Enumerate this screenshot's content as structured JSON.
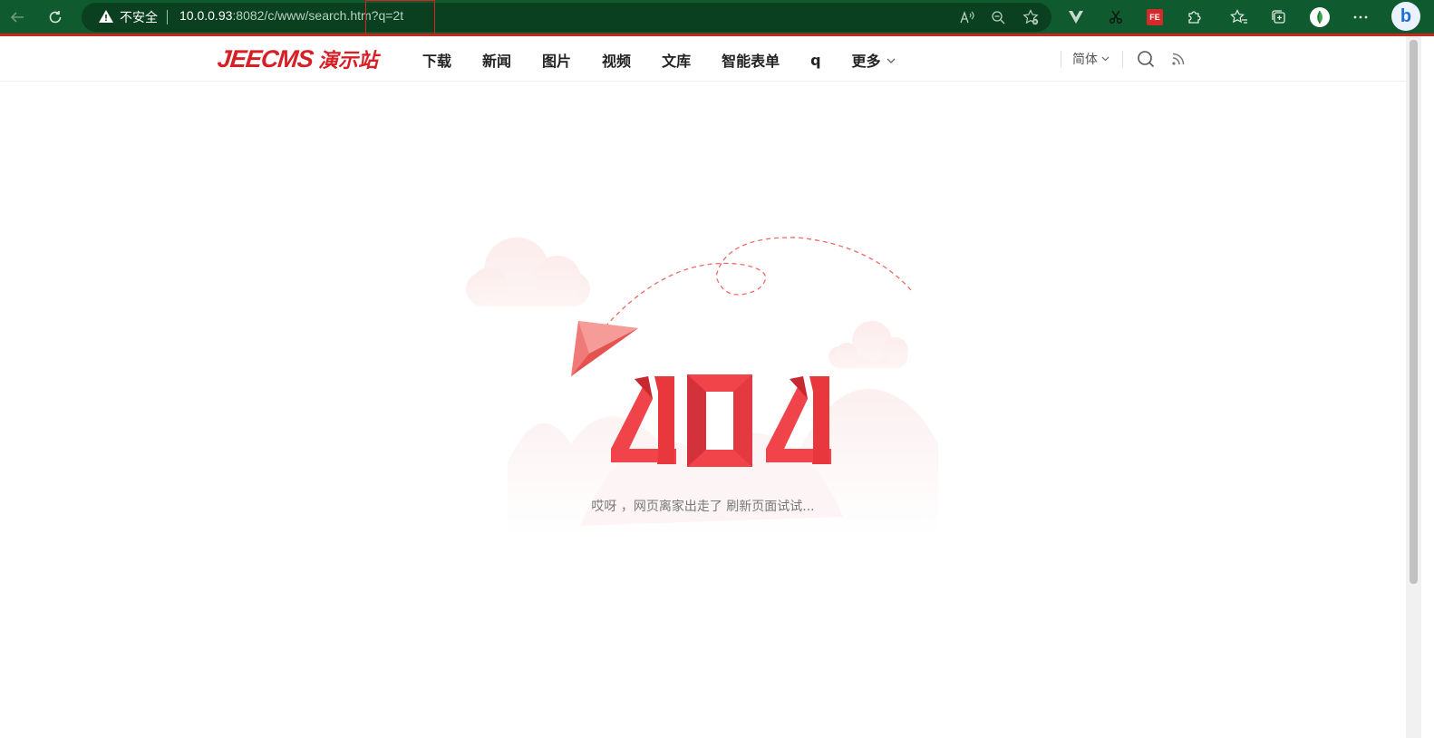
{
  "browser": {
    "security_label": "不安全",
    "url_host": "10.0.0.93",
    "url_rest": ":8082/c/www/search.htm?q=2t",
    "profile_initial": "",
    "bing_label": "b",
    "fe_label": "FE"
  },
  "site": {
    "logo_latin": "JEECMS",
    "logo_cjk": "演示站",
    "nav": [
      {
        "label": "下载"
      },
      {
        "label": "新闻"
      },
      {
        "label": "图片"
      },
      {
        "label": "视频"
      },
      {
        "label": "文库"
      },
      {
        "label": "智能表单"
      },
      {
        "label": "q"
      },
      {
        "label": "更多"
      }
    ],
    "lang_label": "简体"
  },
  "error": {
    "code": "404",
    "message": "哎呀 ，网页离家出走了 刷新页面试试..."
  },
  "colors": {
    "accent": "#d71f26",
    "error_red": "#f0444a",
    "browser_green": "#0f5a2f"
  }
}
